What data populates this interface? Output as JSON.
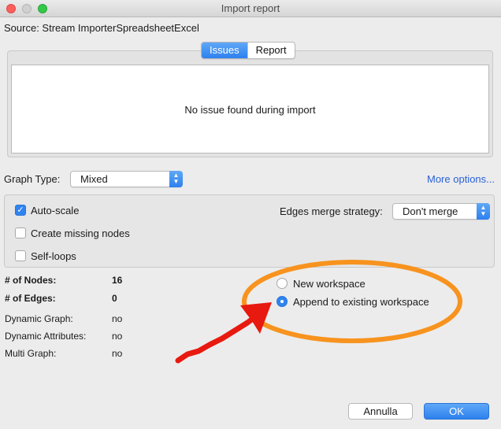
{
  "window": {
    "title": "Import report"
  },
  "source": {
    "text": "Source:  Stream ImporterSpreadsheetExcel"
  },
  "tabs": [
    {
      "label": "Issues",
      "active": true
    },
    {
      "label": "Report",
      "active": false
    }
  ],
  "issues": {
    "message": "No issue found during import"
  },
  "graph_type": {
    "label": "Graph Type:",
    "value": "Mixed"
  },
  "more_options": "More options...",
  "options": {
    "auto_scale": {
      "label": "Auto-scale",
      "checked": true
    },
    "create_missing_nodes": {
      "label": "Create missing nodes",
      "checked": false
    },
    "self_loops": {
      "label": "Self-loops",
      "checked": false
    },
    "edges_merge": {
      "label": "Edges merge strategy:",
      "value": "Don't merge"
    }
  },
  "stats": {
    "nodes_label": "# of Nodes:",
    "nodes_value": "16",
    "edges_label": "# of Edges:",
    "edges_value": "0",
    "dynamic_graph_label": "Dynamic Graph:",
    "dynamic_graph_value": "no",
    "dynamic_attributes_label": "Dynamic Attributes:",
    "dynamic_attributes_value": "no",
    "multi_graph_label": "Multi Graph:",
    "multi_graph_value": "no"
  },
  "workspace": {
    "new_label": "New workspace",
    "append_label": "Append to existing workspace",
    "selected": "append"
  },
  "buttons": {
    "cancel": "Annulla",
    "ok": "OK"
  },
  "annotation": {
    "ellipse_color": "#f7931e",
    "arrow_color": "#e8190f"
  },
  "colors": {
    "accent": "#2d80ee",
    "link": "#2962d9"
  }
}
